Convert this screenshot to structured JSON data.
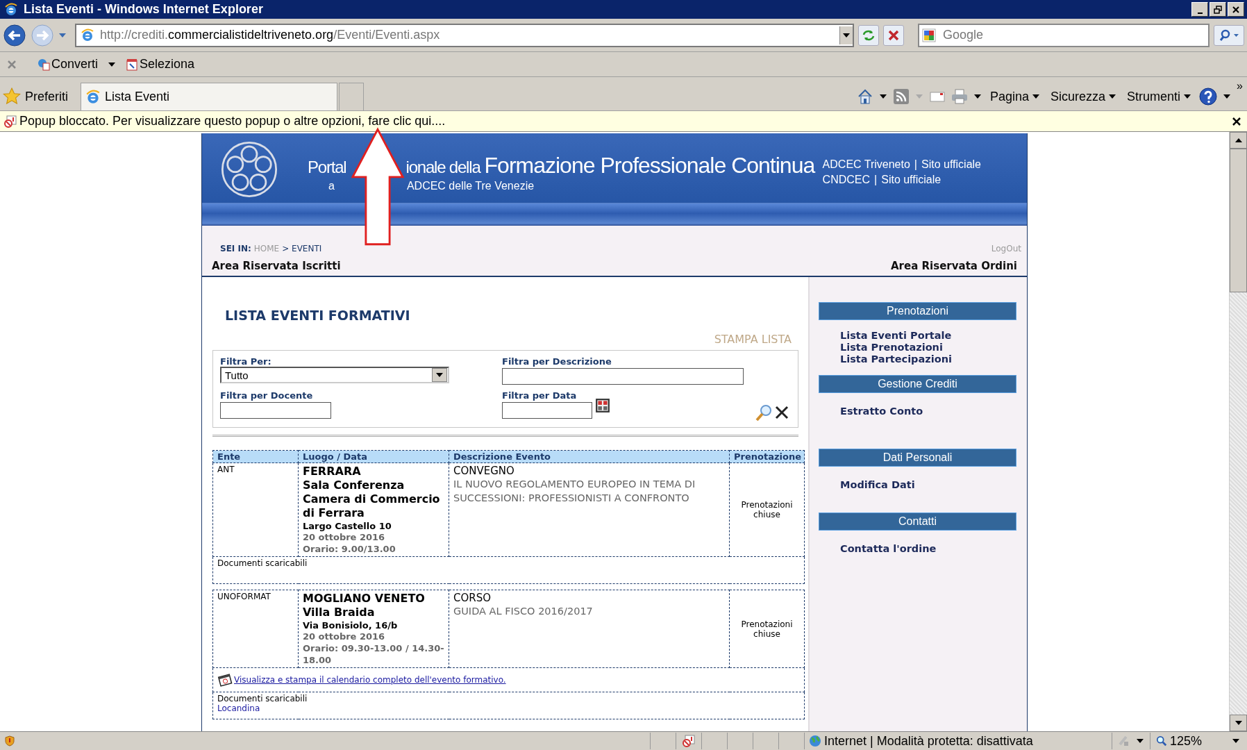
{
  "window": {
    "title": "Lista Eventi - Windows Internet Explorer"
  },
  "address_bar": {
    "url_parts": [
      {
        "text": "http://crediti.",
        "kind": "dim"
      },
      {
        "text": "commercialistideltriveneto.org",
        "kind": "host"
      },
      {
        "text": "/Eventi/Eventi.aspx",
        "kind": "dim"
      }
    ]
  },
  "search_box": {
    "placeholder": "Google"
  },
  "command_bar": {
    "items": [
      "Converti",
      "Seleziona"
    ]
  },
  "favorites": {
    "label": "Preferiti"
  },
  "tabs": [
    {
      "label": "Lista Eventi",
      "selected": true
    }
  ],
  "toolbar_menus": [
    "Pagina",
    "Sicurezza",
    "Strumenti"
  ],
  "toolbar_overflow": "»",
  "info_bar": {
    "text": "Popup bloccato. Per visualizzare questo popup o altre opzioni, fare clic qui...."
  },
  "page": {
    "banner": {
      "title_parts": [
        "Portal",
        "ionale della"
      ],
      "title_main": "Formazione Professionale Continua",
      "subtitle_parts": [
        "a",
        "ADCEC delle Tre Venezie"
      ],
      "links": [
        [
          "ADCEC Triveneto",
          "|",
          "Sito ufficiale"
        ],
        [
          "CNDCEC",
          "|",
          "Sito ufficiale"
        ]
      ]
    },
    "breadcrumb": {
      "label": "SEI IN:",
      "items": [
        {
          "text": "HOME",
          "current": false
        },
        {
          "text": "> EVENTI",
          "current": true
        }
      ]
    },
    "logout": "LogOut",
    "area_left": "Area Riservata Iscritti",
    "area_right": "Area Riservata Ordini",
    "heading": "LISTA EVENTI FORMATIVI",
    "print_link": "STAMPA LISTA",
    "filters": {
      "filter_by": {
        "label": "Filtra Per:",
        "value": "Tutto"
      },
      "description": {
        "label": "Filtra per Descrizione"
      },
      "teacher": {
        "label": "Filtra per Docente"
      },
      "date": {
        "label": "Filtra per Data"
      }
    },
    "table": {
      "columns": [
        "Ente",
        "Luogo / Data",
        "Descrizione Evento",
        "Prenotazione"
      ],
      "events": [
        {
          "ente": "ANT",
          "city": "FERRARA",
          "venue": "Sala Conferenza Camera di Commercio di Ferrara",
          "address": "Largo Castello 10",
          "date": "20 ottobre 2016",
          "time": "Orario: 9.00/13.00",
          "type": "CONVEGNO",
          "title": "IL NUOVO REGOLAMENTO EUROPEO IN TEMA DI SUCCESSIONI: PROFESSIONISTI A CONFRONTO",
          "booking": "Prenotazioni chiuse",
          "documents_label": "Documenti scaricabili"
        },
        {
          "ente": "UNOFORMAT",
          "city": "MOGLIANO VENETO",
          "venue": "Villa Braida",
          "address": "Via Bonisiolo, 16/b",
          "date": "20 ottobre 2016",
          "time": "Orario: 09.30-13.00 / 14.30-18.00",
          "type": "CORSO",
          "title": "GUIDA AL FISCO 2016/2017",
          "booking": "Prenotazioni chiuse",
          "calendar_link": "Visualizza e stampa il calendario completo dell'evento formativo.",
          "documents_label": "Documenti scaricabili",
          "documents": [
            "Locandina"
          ]
        }
      ]
    },
    "sidebar": [
      {
        "title": "Prenotazioni",
        "links": [
          "Lista Eventi Portale",
          "Lista Prenotazioni",
          "Lista Partecipazioni"
        ]
      },
      {
        "title": "Gestione Crediti",
        "links": [
          "Estratto Conto"
        ]
      },
      {
        "title": "Dati Personali",
        "links": [
          "Modifica Dati"
        ]
      },
      {
        "title": "Contatti",
        "links": [
          "Contatta l'ordine"
        ]
      }
    ]
  },
  "status_bar": {
    "zone": "Internet | Modalità protetta: disattivata",
    "zoom": "125%"
  }
}
